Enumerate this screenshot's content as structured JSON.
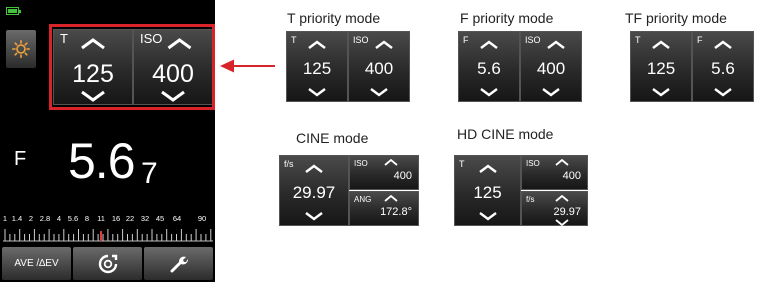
{
  "device": {
    "t_label": "T",
    "t_value": "125",
    "iso_label": "ISO",
    "iso_value": "400",
    "f_label": "F",
    "f_value_main": "5.6",
    "f_value_sub": "7",
    "aperture_scale": [
      "1",
      "1.4",
      "2",
      "2.8",
      "4",
      "5.6",
      "8",
      "11",
      "16",
      "22",
      "32",
      "45",
      "64",
      "90"
    ],
    "bottom_buttons": {
      "left_label": "AVE /∆EV",
      "middle_icon": "memory-reset-icon",
      "right_icon": "wrench-icon"
    },
    "battery_icon": "battery-icon",
    "light_icon": "ambient-light-icon"
  },
  "colors": {
    "highlight": "#d8232a",
    "arrow": "#d8232a",
    "battery": "#43c23c"
  },
  "modes": {
    "t_priority": {
      "title": "T priority mode",
      "left_label": "T",
      "left_value": "125",
      "right_label": "ISO",
      "right_value": "400"
    },
    "f_priority": {
      "title": "F priority mode",
      "left_label": "F",
      "left_value": "5.6",
      "right_label": "ISO",
      "right_value": "400"
    },
    "tf_priority": {
      "title": "TF priority mode",
      "left_label": "T",
      "left_value": "125",
      "right_label": "F",
      "right_value": "5.6"
    },
    "cine": {
      "title": "CINE mode",
      "left_label": "f/s",
      "left_value": "29.97",
      "top_right_label": "ISO",
      "top_right_value": "400",
      "bottom_right_label": "ANG",
      "bottom_right_value": "172.8°"
    },
    "hd_cine": {
      "title": "HD CINE mode",
      "left_label": "T",
      "left_value": "125",
      "top_right_label": "ISO",
      "top_right_value": "400",
      "bottom_right_label": "f/s",
      "bottom_right_value": "29.97"
    }
  }
}
